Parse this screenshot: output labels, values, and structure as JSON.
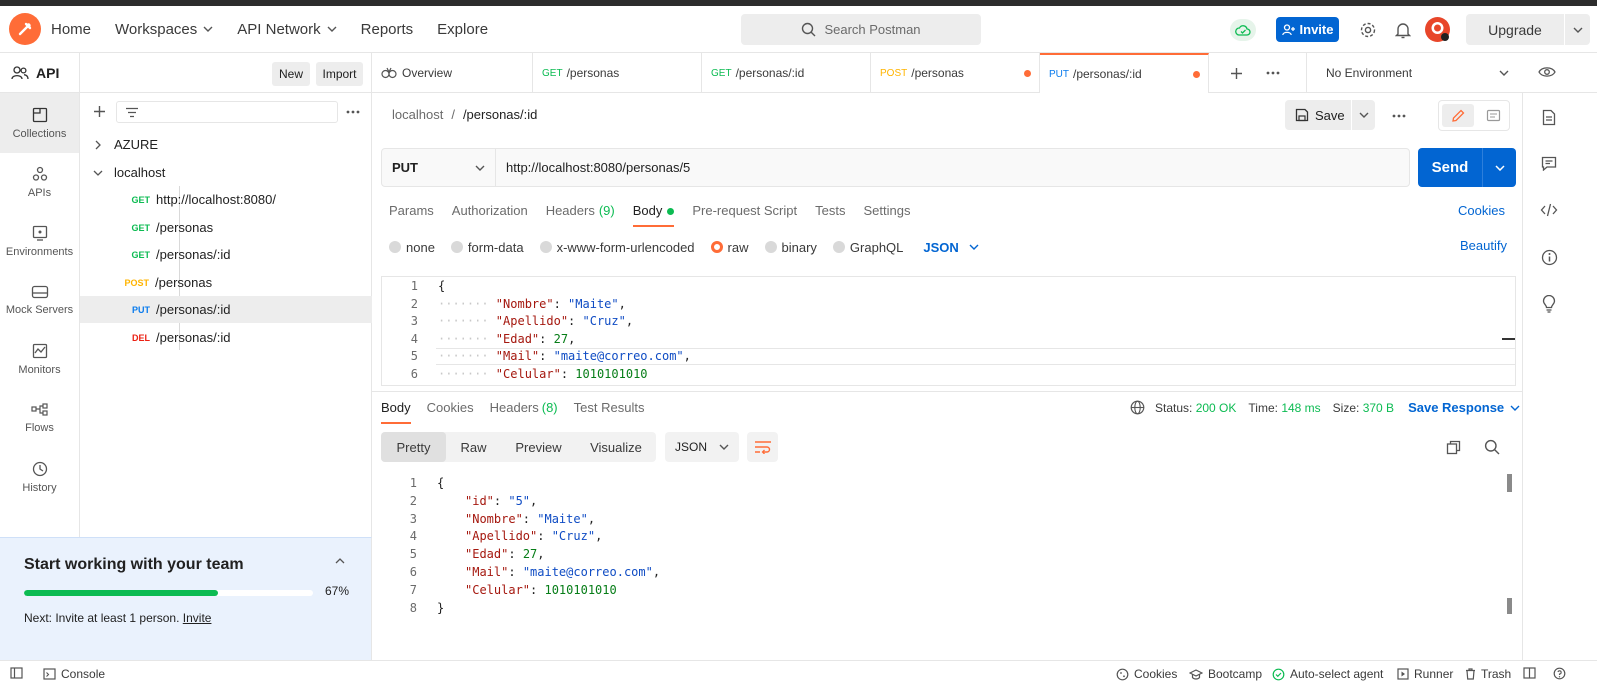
{
  "nav": {
    "home": "Home",
    "workspaces": "Workspaces",
    "api_network": "API Network",
    "reports": "Reports",
    "explore": "Explore"
  },
  "search": {
    "placeholder": "Search Postman"
  },
  "header": {
    "invite": "Invite",
    "upgrade": "Upgrade"
  },
  "workspace": {
    "name": "API",
    "new": "New",
    "import": "Import"
  },
  "rail": [
    "Collections",
    "APIs",
    "Environments",
    "Mock Servers",
    "Monitors",
    "Flows",
    "History"
  ],
  "tree": {
    "collections": [
      {
        "name": "AZURE"
      },
      {
        "name": "localhost"
      }
    ],
    "requests": [
      {
        "method": "GET",
        "path": "http://localhost:8080/"
      },
      {
        "method": "GET",
        "path": "/personas"
      },
      {
        "method": "GET",
        "path": "/personas/:id"
      },
      {
        "method": "POST",
        "path": "/personas"
      },
      {
        "method": "PUT",
        "path": "/personas/:id"
      },
      {
        "method": "DEL",
        "path": "/personas/:id"
      }
    ]
  },
  "team": {
    "title": "Start working with your team",
    "progress": 67,
    "progress_label": "67%",
    "next": "Next: Invite at least 1 person.",
    "invite": "Invite"
  },
  "tabs": [
    {
      "method": "",
      "label": "Overview"
    },
    {
      "method": "GET",
      "label": "/personas"
    },
    {
      "method": "GET",
      "label": "/personas/:id"
    },
    {
      "method": "POST",
      "label": "/personas"
    },
    {
      "method": "PUT",
      "label": "/personas/:id"
    }
  ],
  "environment": "No Environment",
  "breadcrumb": {
    "collection": "localhost",
    "sep": "/",
    "request": "/personas/:id"
  },
  "save": "Save",
  "request": {
    "method": "PUT",
    "url": "http://localhost:8080/personas/5",
    "send": "Send"
  },
  "req_tabs": {
    "params": "Params",
    "authorization": "Authorization",
    "headers": "Headers",
    "headers_count": "(9)",
    "body": "Body",
    "pre_request": "Pre-request Script",
    "tests": "Tests",
    "settings": "Settings",
    "cookies": "Cookies"
  },
  "body_types": {
    "none": "none",
    "form_data": "form-data",
    "urlencoded": "x-www-form-urlencoded",
    "raw": "raw",
    "binary": "binary",
    "graphql": "GraphQL",
    "json": "JSON",
    "beautify": "Beautify"
  },
  "request_body": [
    {
      "ln": "1",
      "text": "{"
    },
    {
      "ln": "2",
      "key": "\"Nombre\"",
      "val": "\"Maite\"",
      "type": "s",
      "comma": ","
    },
    {
      "ln": "3",
      "key": "\"Apellido\"",
      "val": "\"Cruz\"",
      "type": "s",
      "comma": ","
    },
    {
      "ln": "4",
      "key": "\"Edad\"",
      "val": "27",
      "type": "n",
      "comma": ","
    },
    {
      "ln": "5",
      "key": "\"Mail\"",
      "val": "\"maite@correo.com\"",
      "type": "s",
      "comma": ","
    },
    {
      "ln": "6",
      "key": "\"Celular\"",
      "val": "1010101010",
      "type": "n",
      "comma": ""
    }
  ],
  "resp_tabs": {
    "body": "Body",
    "cookies": "Cookies",
    "headers": "Headers",
    "headers_count": "(8)",
    "test_results": "Test Results"
  },
  "resp_meta": {
    "status_label": "Status:",
    "status": "200 OK",
    "time_label": "Time:",
    "time": "148 ms",
    "size_label": "Size:",
    "size": "370 B",
    "save_response": "Save Response"
  },
  "resp_formats": {
    "pretty": "Pretty",
    "raw": "Raw",
    "preview": "Preview",
    "visualize": "Visualize",
    "json": "JSON"
  },
  "response_body": [
    {
      "ln": "1",
      "text": "{"
    },
    {
      "ln": "2",
      "key": "\"id\"",
      "val": "\"5\"",
      "type": "s",
      "comma": ","
    },
    {
      "ln": "3",
      "key": "\"Nombre\"",
      "val": "\"Maite\"",
      "type": "s",
      "comma": ","
    },
    {
      "ln": "4",
      "key": "\"Apellido\"",
      "val": "\"Cruz\"",
      "type": "s",
      "comma": ","
    },
    {
      "ln": "5",
      "key": "\"Edad\"",
      "val": "27",
      "type": "n",
      "comma": ","
    },
    {
      "ln": "6",
      "key": "\"Mail\"",
      "val": "\"maite@correo.com\"",
      "type": "s",
      "comma": ","
    },
    {
      "ln": "7",
      "key": "\"Celular\"",
      "val": "1010101010",
      "type": "n",
      "comma": ""
    },
    {
      "ln": "8",
      "text": "}"
    }
  ],
  "statusbar": {
    "console": "Console",
    "cookies": "Cookies",
    "bootcamp": "Bootcamp",
    "auto_select": "Auto-select agent",
    "runner": "Runner",
    "trash": "Trash"
  },
  "colors": {
    "accent": "#ff6c37",
    "primary": "#0265d2",
    "get": "#0cbb52",
    "post": "#ffb400",
    "put": "#097bed",
    "del": "#eb2013"
  }
}
